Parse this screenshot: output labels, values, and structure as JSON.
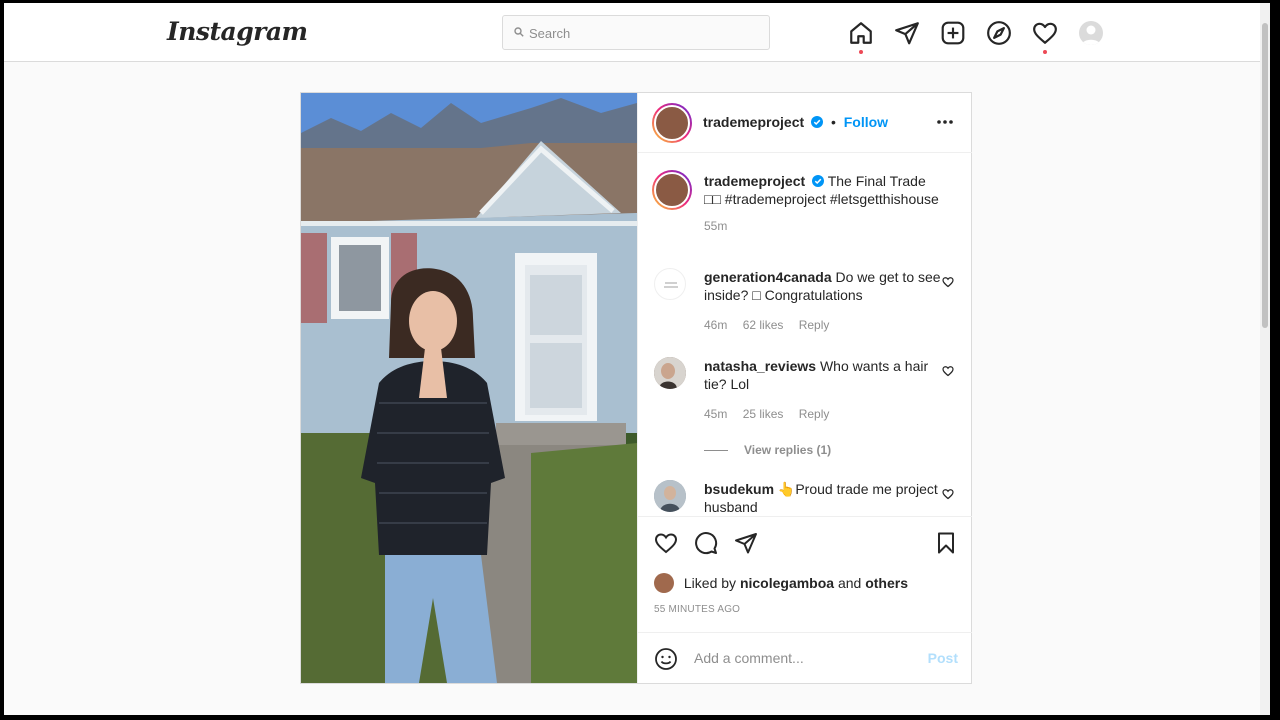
{
  "header": {
    "logo_text": "Instagram",
    "search_placeholder": "Search",
    "icons": [
      "home-icon",
      "direct-icon",
      "new-post-icon",
      "explore-icon",
      "activity-icon",
      "profile-avatar"
    ]
  },
  "post": {
    "author": "trademeproject",
    "separator": "•",
    "follow_label": "Follow",
    "caption": {
      "username": "trademeproject",
      "text": "The Final Trade □□ #trademeproject #letsgetthishouse",
      "time": "55m"
    },
    "comments": [
      {
        "username": "generation4canada",
        "text": "Do we get to see inside? □ Congratulations",
        "time": "46m",
        "likes": "62 likes",
        "reply": "Reply"
      },
      {
        "username": "natasha_reviews",
        "text": "Who wants a hair tie? Lol",
        "time": "45m",
        "likes": "25 likes",
        "reply": "Reply",
        "view_replies": "View replies (1)"
      },
      {
        "username": "bsudekum",
        "text": "👆Proud trade me project husband"
      }
    ],
    "liked_by_prefix": "Liked by",
    "liked_by_user": "nicolegamboa",
    "liked_by_and": "and",
    "liked_by_others": "others",
    "timestamp": "55 MINUTES AGO",
    "add_comment_placeholder": "Add a comment...",
    "post_button": "Post"
  },
  "colors": {
    "accent": "#0095f6",
    "notification_dot": "#ed4956",
    "border": "#dbdbdb"
  }
}
